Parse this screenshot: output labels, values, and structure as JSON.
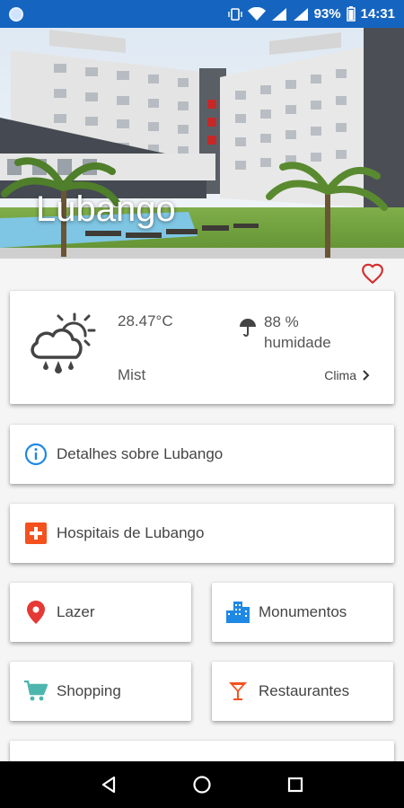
{
  "status_bar": {
    "battery": "93%",
    "time": "14:31"
  },
  "hero": {
    "city": "Lubango"
  },
  "weather": {
    "temperature": "28.47°C",
    "condition": "Mist",
    "humidity_value": "88 %",
    "humidity_label": "humidade",
    "link_label": "Clima"
  },
  "menu": {
    "details": "Detalhes sobre Lubango",
    "hospitals": "Hospitais de Lubango",
    "leisure": "Lazer",
    "monuments": "Monumentos",
    "shopping": "Shopping",
    "restaurants": "Restaurantes"
  },
  "colors": {
    "status_bar": "#1565c0",
    "heart": "#d32f2f",
    "info": "#1e88e5",
    "hospital": "#f4511e",
    "location": "#e53935",
    "monument": "#1e88e5",
    "shopping": "#4db6ac",
    "restaurant": "#f4511e"
  },
  "icons": {
    "weather": "cloud-rain-sun-icon",
    "humidity": "umbrella-icon",
    "favorite": "heart-outline-icon"
  }
}
